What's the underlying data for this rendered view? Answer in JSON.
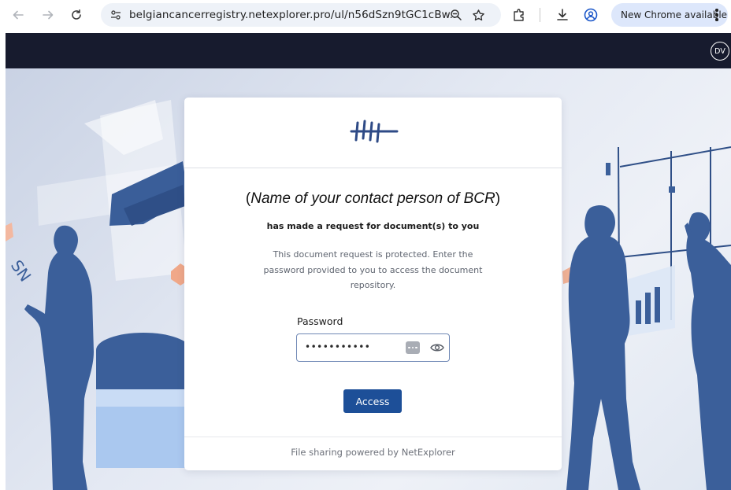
{
  "browser": {
    "url": "belgiancancerregistry.netexplorer.pro/ul/n56dSzn9tGC1cBw...",
    "update_label": "New Chrome available",
    "icons": {
      "back": "arrow-left-icon",
      "forward": "arrow-right-icon",
      "reload": "reload-icon",
      "site_info": "tune-icon",
      "zoom": "zoom-icon",
      "bookmark": "star-icon",
      "extensions": "puzzle-icon",
      "downloads": "download-icon",
      "profile": "profile-icon",
      "menu": "kebab-menu-icon"
    }
  },
  "header": {
    "avatar_initials": "DV"
  },
  "request": {
    "contact_name": "Name of your contact person of BCR",
    "contact_open": "(",
    "contact_close": ")",
    "subtitle": "has made a request for document(s) to you",
    "description": "This document request is protected. Enter the password provided to you to access the document repository."
  },
  "form": {
    "password_label": "Password",
    "password_value": "•••••••••••",
    "submit_label": "Access"
  },
  "footer": {
    "text": "File sharing powered by NetExplorer"
  },
  "colors": {
    "header_bg": "#171b2e",
    "accent": "#1d4f98",
    "silhouette": "#3b5f9a",
    "update_pill": "#dde7fb"
  }
}
